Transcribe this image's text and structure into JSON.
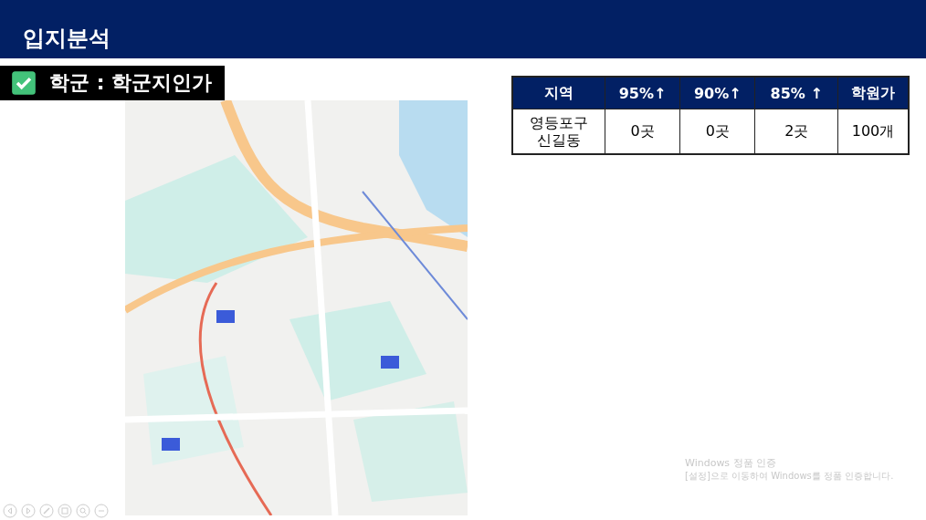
{
  "slide": {
    "title": "입지분석",
    "subtitle": "학군 : 학군지인가",
    "checked": true
  },
  "table": {
    "columns": [
      "지역",
      "95%↑",
      "90%↑",
      "85% ↑",
      "학원가"
    ],
    "rows": [
      [
        "영등포구\n신길동",
        "0곳",
        "0곳",
        "2곳",
        "100개"
      ]
    ]
  },
  "activation": {
    "title": "Windows 정품 인증",
    "message": "[설정]으로 이동하여 Windows를 정품 인증합니다."
  },
  "controls": [
    {
      "kind": "prev"
    },
    {
      "kind": "next"
    },
    {
      "kind": "pen"
    },
    {
      "kind": "slides"
    },
    {
      "kind": "zoom"
    },
    {
      "kind": "more"
    }
  ]
}
